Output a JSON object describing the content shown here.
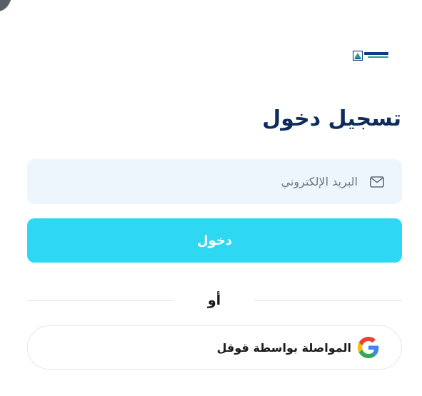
{
  "page": {
    "title": "تسجيل دخول"
  },
  "logo": {
    "icon": "brand-logo",
    "colors": {
      "primary": "#0f3b86",
      "secondary": "#2a9d8f"
    }
  },
  "form": {
    "email": {
      "placeholder": "البريد الإلكتروني",
      "value": "",
      "icon": "mail-icon"
    },
    "submit_label": "دخول"
  },
  "divider": {
    "label": "أو"
  },
  "social": {
    "google_label": "المواصلة بواسطة قوقل",
    "icon": "google-icon"
  },
  "colors": {
    "title": "#0d2c5c",
    "button": "#2ed8f3",
    "input_background": "#eef6fd"
  }
}
